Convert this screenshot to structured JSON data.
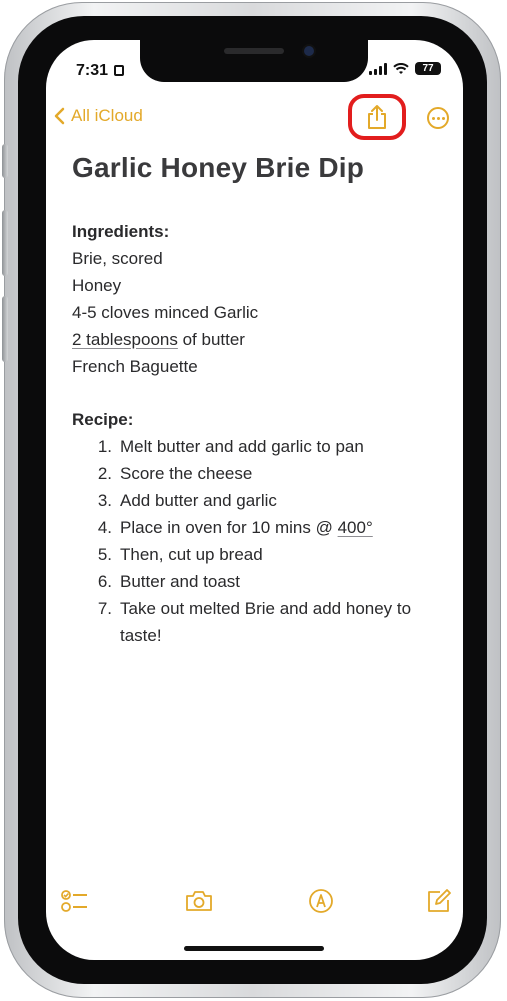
{
  "status_bar": {
    "time": "7:31",
    "battery": "77"
  },
  "nav": {
    "back_label": "All iCloud"
  },
  "note": {
    "title": "Garlic Honey Brie Dip",
    "ingredients_heading": "Ingredients:",
    "ingredients": [
      "Brie, scored",
      "Honey",
      "4-5 cloves minced Garlic",
      {
        "underlined": "2 tablespoons",
        "rest": " of butter"
      },
      "French Baguette"
    ],
    "recipe_heading": "Recipe:",
    "steps": [
      {
        "num": "1.",
        "text": "Melt butter and add garlic to pan"
      },
      {
        "num": "2.",
        "text": "Score the cheese"
      },
      {
        "num": "3.",
        "text": "Add butter and garlic"
      },
      {
        "num": "4.",
        "text": "Place in oven for 10 mins @ ",
        "underlined": "400°"
      },
      {
        "num": "5.",
        "text": "Then, cut up bread"
      },
      {
        "num": "6.",
        "text": "Butter and toast"
      },
      {
        "num": "7.",
        "text": "Take out melted Brie and add honey to",
        "cont": "taste!"
      }
    ]
  },
  "toolbar": {
    "icons": [
      "checklist-icon",
      "camera-icon",
      "markup-icon",
      "compose-icon"
    ]
  },
  "colors": {
    "accent": "#e3a92a",
    "highlight": "#e21d1d"
  }
}
